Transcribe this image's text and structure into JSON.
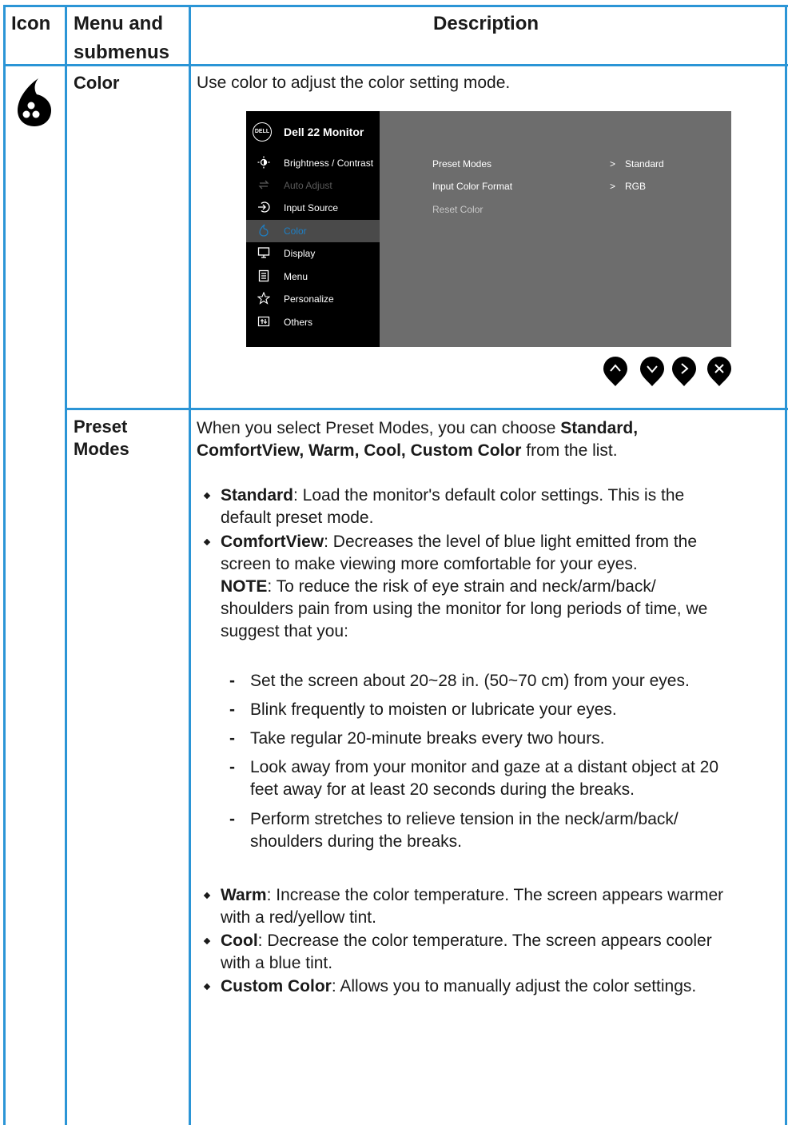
{
  "header": {
    "icon": "Icon",
    "menu_line1": "Menu and",
    "menu_line2": "submenus",
    "description": "Description"
  },
  "color_row": {
    "menu": "Color",
    "description": "Use color to adjust the color setting mode."
  },
  "osd": {
    "title": "Dell 22 Monitor",
    "logo_text": "DELL",
    "menu_items": [
      {
        "label": "Brightness / Contrast",
        "icon": "brightness-icon"
      },
      {
        "label": "Auto Adjust",
        "icon": "auto-adjust-icon"
      },
      {
        "label": "Input Source",
        "icon": "input-source-icon"
      },
      {
        "label": "Color",
        "icon": "color-drop-icon"
      },
      {
        "label": "Display",
        "icon": "display-icon"
      },
      {
        "label": "Menu",
        "icon": "menu-icon"
      },
      {
        "label": "Personalize",
        "icon": "star-icon"
      },
      {
        "label": "Others",
        "icon": "others-icon"
      }
    ],
    "settings": [
      {
        "label": "Preset Modes",
        "arrow": ">",
        "value": "Standard"
      },
      {
        "label": "Input Color Format",
        "arrow": ">",
        "value": "RGB"
      },
      {
        "label": "Reset Color",
        "arrow": "",
        "value": ""
      }
    ],
    "nav_buttons": [
      "up-button",
      "down-button",
      "right-button",
      "close-button"
    ]
  },
  "preset_row": {
    "menu_line1": "Preset",
    "menu_line2": "Modes",
    "intro_a": "When you select Preset Modes, you can choose ",
    "intro_b": "Standard,",
    "intro_c": "ComfortView, Warm, Cool, Custom Color",
    "intro_d": " from the list.",
    "standard_term": "Standard",
    "standard_desc_1": ": Load the monitor's default color settings. This is the",
    "standard_desc_2": "default preset mode.",
    "comfort_term": "ComfortView",
    "comfort_desc_1": ": Decreases the level of blue light emitted from the",
    "comfort_desc_2": "screen to make viewing more comfortable for your eyes.",
    "note_term": "NOTE",
    "note_1": ": To reduce the risk of eye strain and neck/arm/back/",
    "note_2": "shoulders pain from using the monitor for long periods of time, we",
    "note_3": "suggest that you:",
    "tips": [
      "Set the screen about 20~28 in. (50~70 cm) from your eyes.",
      "Blink frequently to moisten or lubricate your eyes.",
      "Take regular 20-minute breaks every two hours.",
      "Look away from your monitor and gaze at a distant object at 20",
      "feet away for at least 20 seconds during the breaks.",
      "Perform stretches to relieve tension in the neck/arm/back/",
      "shoulders during the breaks."
    ],
    "warm_term": "Warm",
    "warm_1": ": Increase the color temperature. The screen appears warmer",
    "warm_2": "with a red/yellow tint.",
    "cool_term": "Cool",
    "cool_1": ": Decrease the color temperature. The screen appears cooler",
    "cool_2": "with a blue tint.",
    "custom_term": "Custom Color",
    "custom_1": ": Allows you to manually adjust the color settings."
  },
  "colors": {
    "border": "#2b95d6",
    "osd_panel": "#6d6d6d",
    "osd_menu": "#000000",
    "osd_selected_text": "#1e7fc4"
  }
}
